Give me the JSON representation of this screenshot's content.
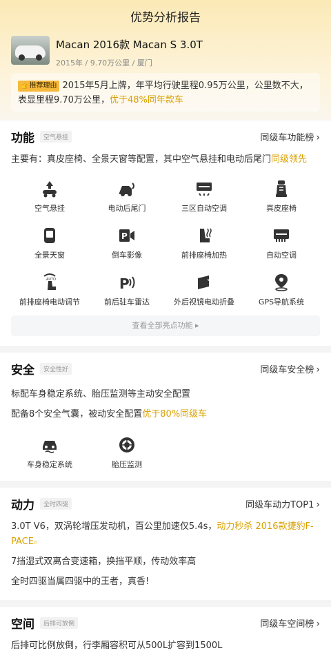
{
  "header": {
    "title": "优势分析报告"
  },
  "car": {
    "name": "Macan 2016款 Macan S 3.0T",
    "meta": "2015年 / 9.70万公里 / 厦门"
  },
  "reason": {
    "tag": "推荐理由",
    "text": "2015年5月上牌，年平均行驶里程0.95万公里，公里数不大，表显里程9.70万公里，",
    "highlight": "优于48%同年款车"
  },
  "function": {
    "title": "功能",
    "tag": "空气悬挂",
    "rank": "同级车功能榜",
    "desc": "主要有：真皮座椅、全景天窗等配置，其中空气悬挂和电动后尾门",
    "desc_highlight": "同级领先",
    "features": [
      {
        "label": "空气悬挂",
        "icon": "air-suspension-icon"
      },
      {
        "label": "电动后尾门",
        "icon": "power-tailgate-icon"
      },
      {
        "label": "三区自动空调",
        "icon": "tri-zone-ac-icon"
      },
      {
        "label": "真皮座椅",
        "icon": "leather-seat-icon"
      },
      {
        "label": "全景天窗",
        "icon": "panoramic-sunroof-icon"
      },
      {
        "label": "倒车影像",
        "icon": "reverse-camera-icon"
      },
      {
        "label": "前排座椅加热",
        "icon": "seat-heating-icon"
      },
      {
        "label": "自动空调",
        "icon": "auto-ac-icon"
      },
      {
        "label": "前排座椅电动调节",
        "icon": "power-seat-icon"
      },
      {
        "label": "前后驻车雷达",
        "icon": "parking-radar-icon"
      },
      {
        "label": "外后视镜电动折叠",
        "icon": "mirror-fold-icon"
      },
      {
        "label": "GPS导航系统",
        "icon": "gps-icon"
      }
    ],
    "view_all": "查看全部亮点功能 ▸"
  },
  "safety": {
    "title": "安全",
    "tag": "安全性好",
    "rank": "同级车安全榜",
    "desc1": "标配车身稳定系统、胎压监测等主动安全配置",
    "desc2": "配备8个安全气囊，被动安全配置",
    "desc2_highlight": "优于80%同级车",
    "features": [
      {
        "label": "车身稳定系统",
        "icon": "stability-control-icon"
      },
      {
        "label": "胎压监测",
        "icon": "tire-pressure-icon"
      }
    ]
  },
  "power": {
    "title": "动力",
    "tag": "全时四驱",
    "rank": "同级车动力TOP1",
    "desc1": "3.0T V6，双涡轮增压发动机，百公里加速仅5.4s，",
    "desc1_highlight": "动力秒杀 2016款捷豹F-PACE",
    "desc2": "7挡湿式双离合变速箱，换挡平顺，传动效率高",
    "desc3": "全时四驱当属四驱中的王者，真香!"
  },
  "space": {
    "title": "空间",
    "tag": "后排可放倒",
    "rank": "同级车空间榜",
    "desc": "后排可比例放倒，行李厢容积可从500L扩容到1500L"
  },
  "colors": {
    "accent": "#d8a000",
    "tag_bg": "#f6b93b",
    "hero": "#fbe9b6"
  }
}
